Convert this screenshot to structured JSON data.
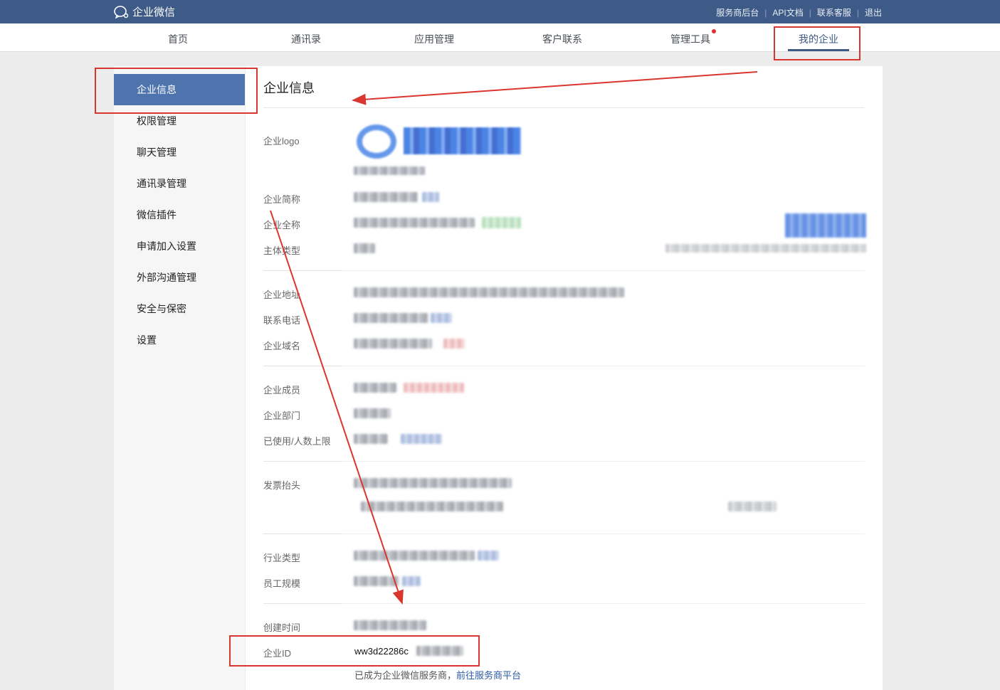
{
  "header": {
    "app_name": "企业微信",
    "links": [
      "服务商后台",
      "API文档",
      "联系客服",
      "退出"
    ]
  },
  "nav": {
    "tabs": [
      "首页",
      "通讯录",
      "应用管理",
      "客户联系",
      "管理工具",
      "我的企业"
    ],
    "active_tab": "我的企业"
  },
  "sidebar": {
    "items": [
      "企业信息",
      "权限管理",
      "聊天管理",
      "通讯录管理",
      "微信插件",
      "申请加入设置",
      "外部沟通管理",
      "安全与保密",
      "设置"
    ],
    "active_item": "企业信息"
  },
  "main": {
    "title": "企业信息",
    "labels": {
      "logo": "企业logo",
      "short_name": "企业简称",
      "full_name": "企业全称",
      "entity_type": "主体类型",
      "address": "企业地址",
      "phone": "联系电话",
      "domain": "企业域名",
      "members": "企业成员",
      "departments": "企业部门",
      "usage_limit": "已使用/人数上限",
      "invoice_title": "发票抬头",
      "industry": "行业类型",
      "staff_size": "员工规模",
      "created_time": "创建时间",
      "corp_id": "企业ID"
    },
    "corp_id_visible": "ww3d22286c",
    "footer_note": "已成为企业微信服务商，",
    "footer_link": "前往服务商平台"
  },
  "colors": {
    "header_bg": "#3e5a86",
    "active_sidebar": "#4f74ad",
    "annotation_red": "#d9362f"
  }
}
